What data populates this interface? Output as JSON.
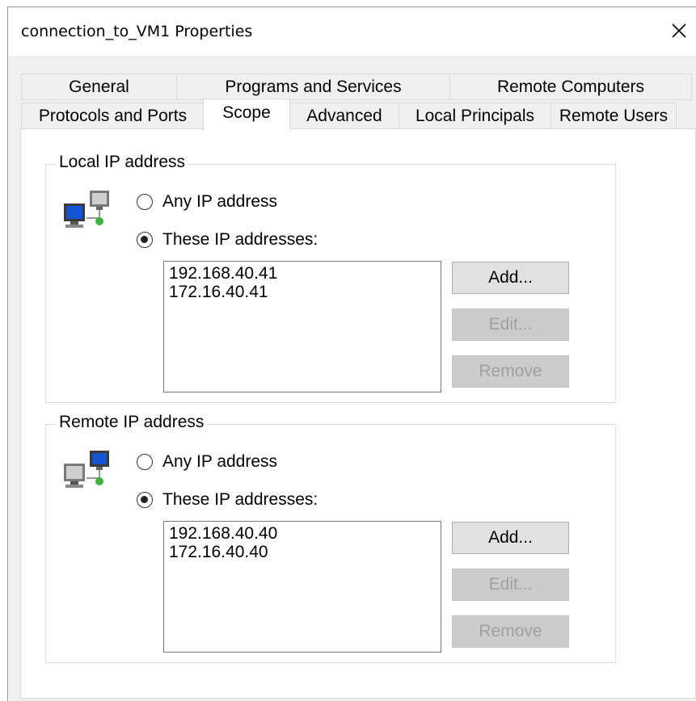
{
  "window": {
    "title": "connection_to_VM1 Properties"
  },
  "tabs": {
    "row1": [
      "General",
      "Programs and Services",
      "Remote Computers"
    ],
    "row2": [
      "Protocols and Ports",
      "Scope",
      "Advanced",
      "Local Principals",
      "Remote Users"
    ],
    "active": "Scope"
  },
  "local": {
    "group_title": "Local IP address",
    "any_label": "Any IP address",
    "these_label": "These IP addresses:",
    "selected": "these",
    "addresses": [
      "192.168.40.41",
      "172.16.40.41"
    ],
    "add_label": "Add...",
    "edit_label": "Edit...",
    "remove_label": "Remove"
  },
  "remote": {
    "group_title": "Remote IP address",
    "any_label": "Any IP address",
    "these_label": "These IP addresses:",
    "selected": "these",
    "addresses": [
      "192.168.40.40",
      "172.16.40.40"
    ],
    "add_label": "Add...",
    "edit_label": "Edit...",
    "remove_label": "Remove"
  },
  "icons": {
    "close": "close-icon",
    "network": "network-computers-icon"
  },
  "colors": {
    "dialog_bg": "#f0f0f0",
    "panel_bg": "#ffffff",
    "disabled_text": "#a0a0a0"
  }
}
